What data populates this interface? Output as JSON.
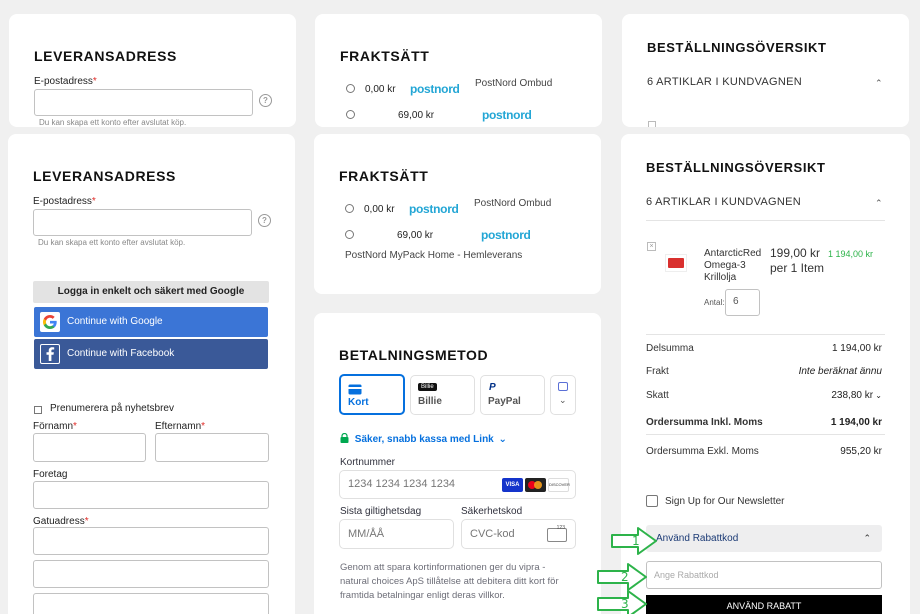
{
  "shipping_address": {
    "heading": "LEVERANSADRESS",
    "email_label": "E-postadress",
    "email_value": "",
    "email_hint": "Du kan skapa ett konto efter avslutat köp.",
    "help_glyph": "?",
    "google_login_label": "Logga in enkelt och säkert med Google",
    "continue_google": "Continue with Google",
    "continue_facebook": "Continue with Facebook",
    "newsletter_label": "Prenumerera på nyhetsbrev",
    "firstname_label": "Förnamn",
    "lastname_label": "Efternamn",
    "company_label": "Foretag",
    "street_label": "Gatuadress",
    "required_mark": "*"
  },
  "shipping_method": {
    "heading": "FRAKTSÄTT",
    "options": [
      {
        "price": "0,00 kr",
        "logo": "postnord",
        "carrier": "PostNord Ombud"
      },
      {
        "price": "69,00 kr",
        "logo": "postnord",
        "carrier": "PostNord MyPack Home - Hemleverans"
      }
    ]
  },
  "payment": {
    "heading": "BETALNINGSMETOD",
    "tabs": [
      {
        "label": "Kort",
        "icon": "card-icon",
        "active": true
      },
      {
        "label": "Billie",
        "icon": "billie-logo",
        "badge": "Billie",
        "active": false
      },
      {
        "label": "PayPal",
        "icon": "paypal-icon",
        "active": false
      }
    ],
    "link_text": "Säker, snabb kassa med Link",
    "card_number_label": "Kortnummer",
    "card_number_placeholder": "1234 1234 1234 1234",
    "card_brands": [
      "VISA",
      "",
      "DISCOVER"
    ],
    "expiry_label": "Sista giltighetsdag",
    "expiry_placeholder": "MM/ÅÅ",
    "cvc_label": "Säkerhetskod",
    "cvc_placeholder": "CVC-kod",
    "cvc_icon_text": "123",
    "disclaimer": "Genom att spara kortinformationen ger du vipra - natural choices ApS tillåtelse att debitera ditt kort för framtida betalningar enligt deras villkor."
  },
  "order_summary": {
    "heading": "BESTÄLLNINGSÖVERSIKT",
    "cart_count_label": "6 ARTIKLAR I KUNDVAGNEN",
    "item": {
      "name": "AntarcticRed Omega-3 Krillolja",
      "price_per": "199,00 kr per 1 Item",
      "total": "1 194,00 kr",
      "qty_label": "Antal:",
      "qty": "6"
    },
    "rows": [
      {
        "label": "Delsumma",
        "value": "1 194,00 kr"
      },
      {
        "label": "Frakt",
        "value": "Inte beräknat ännu"
      },
      {
        "label": "Skatt",
        "value": "238,80 kr"
      },
      {
        "label": "Ordersumma Inkl. Moms",
        "value": "1 194,00 kr"
      },
      {
        "label": "Ordersumma Exkl. Moms",
        "value": "955,20 kr"
      }
    ],
    "signup_label": "Sign Up for Our Newsletter",
    "discount_toggle": "Använd Rabattkod",
    "discount_placeholder": "Ange Rabattkod",
    "discount_apply": "ANVÄND RABATT"
  },
  "annotations": {
    "steps": [
      "1",
      "2",
      "3"
    ],
    "arrow_color": "#2db34a"
  },
  "colors": {
    "google_blue": "#3b75d6",
    "facebook_blue": "#3a5998",
    "stripe_blue": "#0570de",
    "link_green": "#00a850",
    "postnord_blue": "#23a6d5"
  }
}
